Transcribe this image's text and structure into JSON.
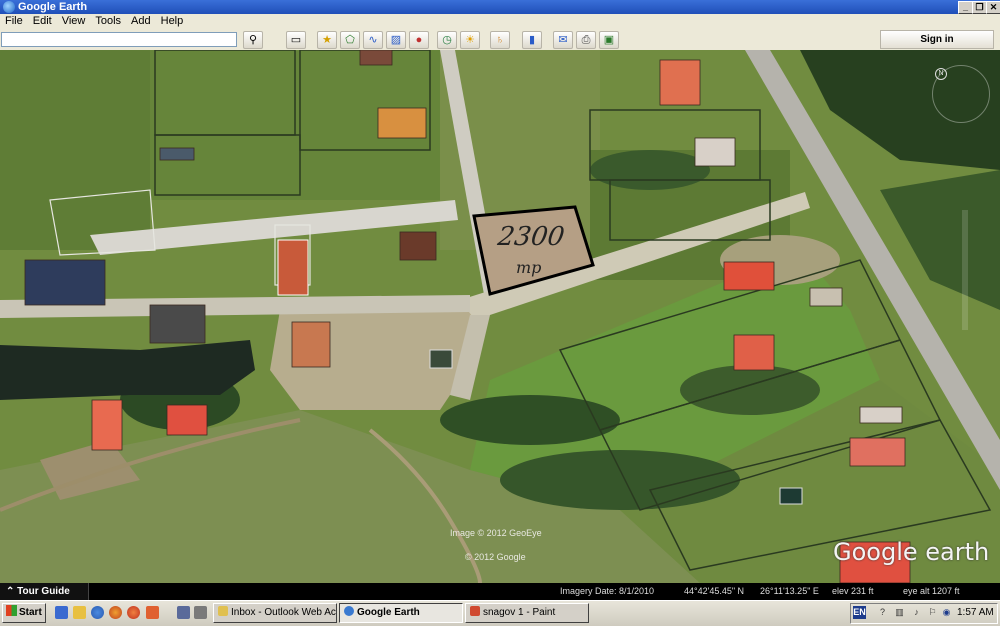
{
  "window": {
    "title": "Google Earth"
  },
  "menu": [
    "File",
    "Edit",
    "View",
    "Tools",
    "Add",
    "Help"
  ],
  "toolbar": {
    "search_value": "",
    "sign_in_label": "Sign in",
    "icons": [
      "search-icon",
      "sidebar-toggle-icon",
      "placemark-icon",
      "polygon-icon",
      "path-icon",
      "image-overlay-icon",
      "record-tour-icon",
      "historical-imagery-icon",
      "sunlight-icon",
      "planet-icon",
      "ruler-icon",
      "email-icon",
      "print-icon",
      "save-image-icon"
    ]
  },
  "map": {
    "annotation_text": "2300",
    "annotation_unit": "mp",
    "watermark_image": "Image © 2012 GeoEye",
    "watermark_google": "© 2012 Google",
    "logo_text": "Google earth"
  },
  "statusbar": {
    "tour_guide": "Tour Guide",
    "imagery_date": "Imagery Date: 8/1/2010",
    "lat": "44°42'45.45\" N",
    "lon": "26°11'13.25\" E",
    "elev": "elev  231 ft",
    "eye_alt": "eye alt  1207 ft"
  },
  "taskbar": {
    "start_label": "Start",
    "tasks": [
      "Inbox - Outlook Web Acc...",
      "Google Earth",
      "snagov 1 - Paint"
    ],
    "language": "EN",
    "clock": "1:57 AM"
  },
  "colors": {
    "titlebar": "#2a5cc8",
    "status_bg": "#000000"
  }
}
